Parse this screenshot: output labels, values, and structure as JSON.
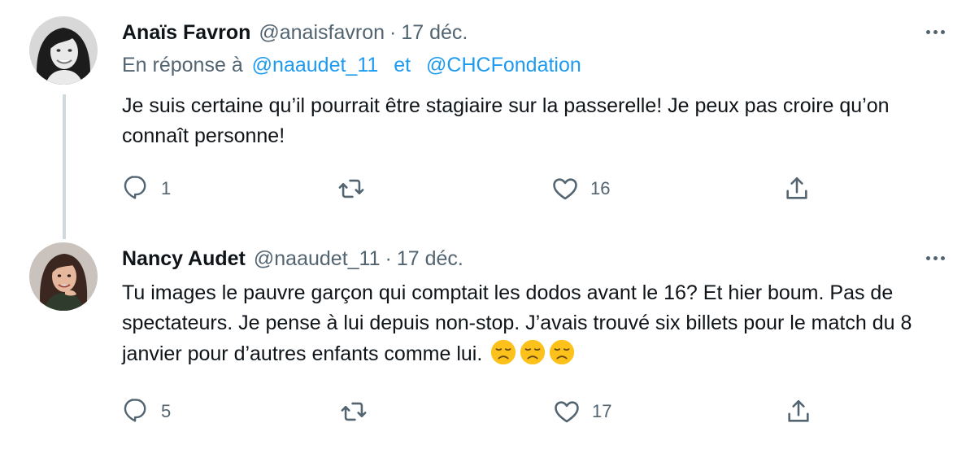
{
  "tweets": [
    {
      "author_name": "Anaïs Favron",
      "handle": "@anaisfavron",
      "separator": "·",
      "date": "17 déc.",
      "reply_prefix": "En réponse à",
      "reply_mentions": [
        "@naaudet_11",
        "@CHCFondation"
      ],
      "reply_joiner": "et",
      "text": "Je suis certaine qu’il pourrait être stagiaire sur la passerelle! Je peux pas croire qu’on connaît personne!",
      "reply_count": "1",
      "retweet_count": "",
      "like_count": "16"
    },
    {
      "author_name": "Nancy Audet",
      "handle": "@naaudet_11",
      "separator": "·",
      "date": "17 déc.",
      "text": "Tu images le pauvre garçon qui comptait les dodos avant le 16? Et hier boum. Pas de spectateurs. Je pense à lui depuis non-stop. J’avais trouvé six billets pour le match du 8 janvier pour d’autres enfants comme lui.",
      "emoji": [
        "disappointed-face",
        "disappointed-face",
        "disappointed-face"
      ],
      "reply_count": "5",
      "retweet_count": "",
      "like_count": "17"
    }
  ],
  "colors": {
    "text": "#0f1419",
    "secondary": "#536471",
    "link": "#1d9bf0",
    "thread_line": "#cfd9de"
  },
  "icons": [
    "reply-icon",
    "retweet-icon",
    "like-icon",
    "share-icon",
    "more-icon"
  ]
}
